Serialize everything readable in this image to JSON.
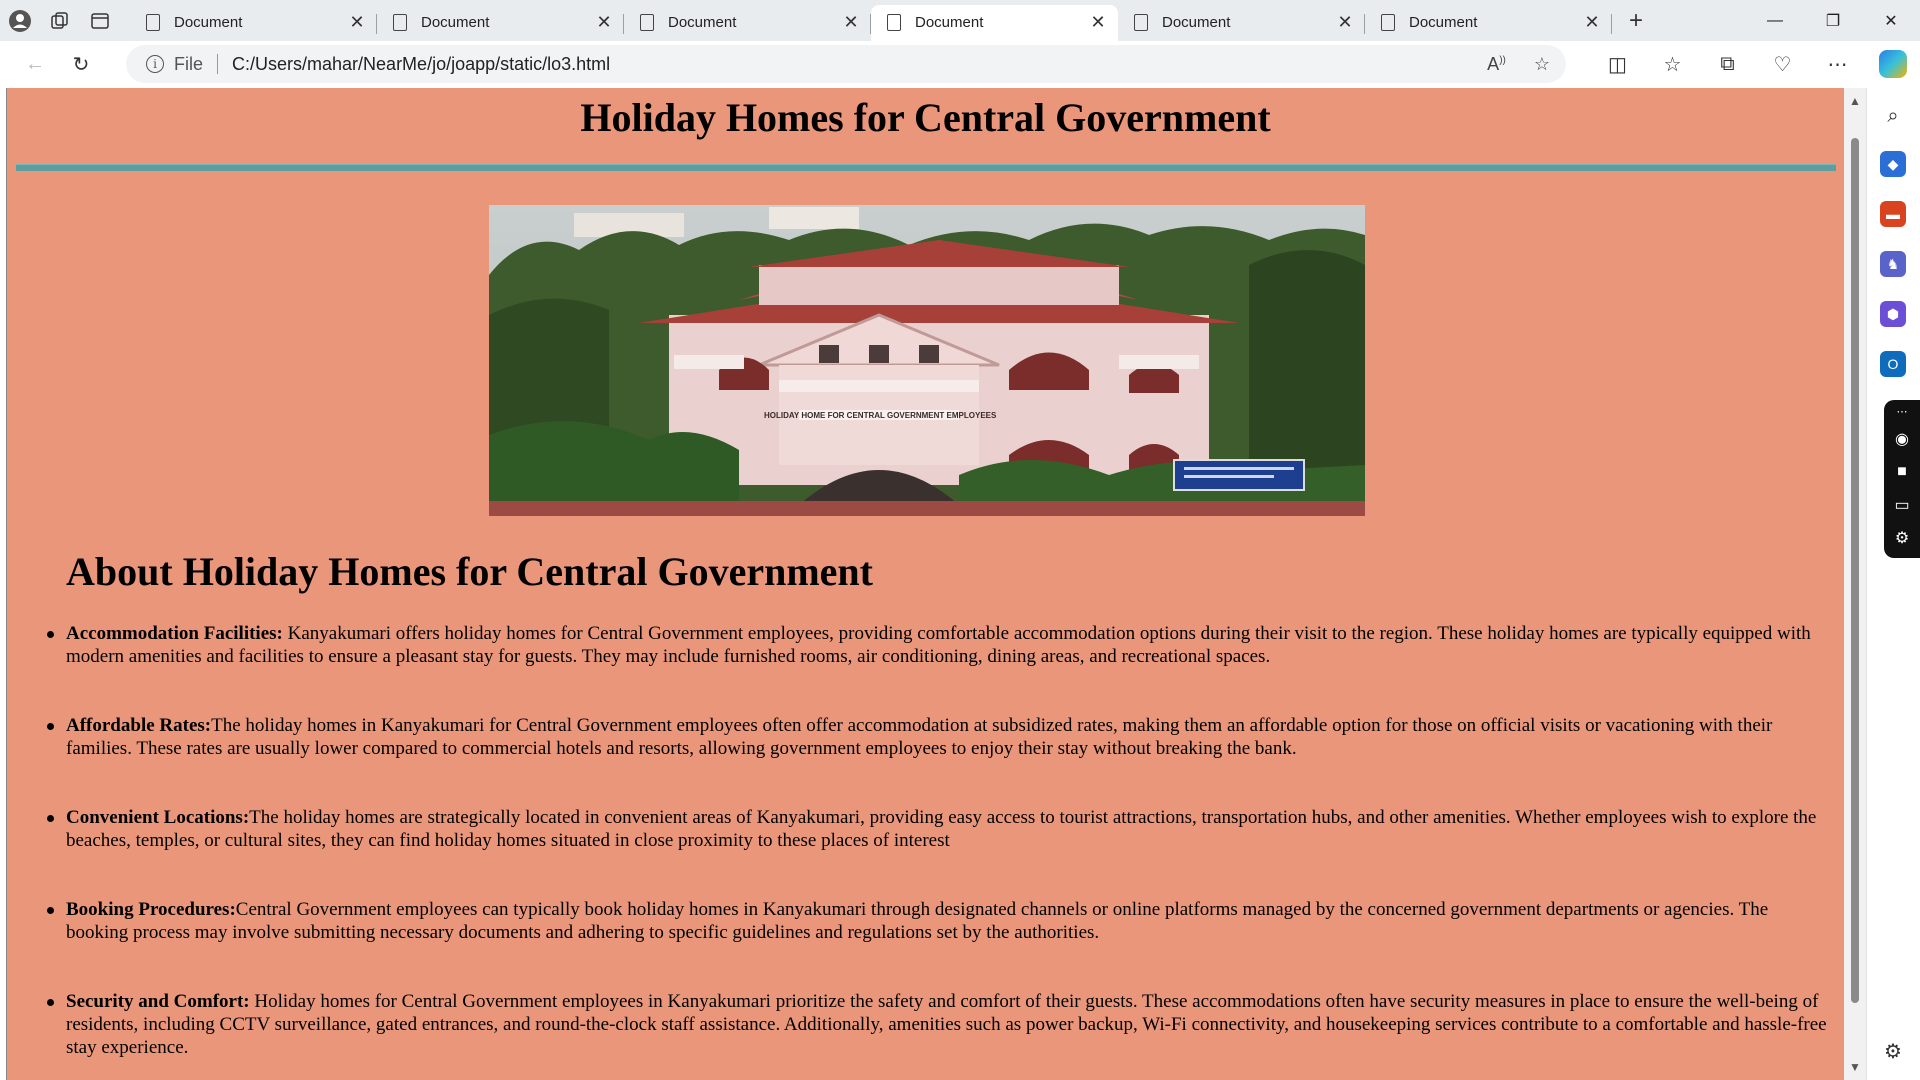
{
  "browser": {
    "tabs": [
      {
        "label": "Document",
        "active": false
      },
      {
        "label": "Document",
        "active": false
      },
      {
        "label": "Document",
        "active": false
      },
      {
        "label": "Document",
        "active": true
      },
      {
        "label": "Document",
        "active": false
      },
      {
        "label": "Document",
        "active": false
      }
    ],
    "address": {
      "scheme_label": "File",
      "url": "C:/Users/mahar/NearMe/jo/joapp/static/lo3.html"
    }
  },
  "page": {
    "title": "Holiday Homes for Central Government",
    "image_sign_text": "HOLIDAY HOME FOR CENTRAL GOVERNMENT EMPLOYEES",
    "about_heading": "About Holiday Homes for Central Government",
    "features": [
      {
        "heading": "Accommodation Facilities:",
        "text": " Kanyakumari offers holiday homes for Central Government employees, providing comfortable accommodation options during their visit to the region. These holiday homes are typically equipped with modern amenities and facilities to ensure a pleasant stay for guests. They may include furnished rooms, air conditioning, dining areas, and recreational spaces."
      },
      {
        "heading": "Affordable Rates:",
        "text": "The holiday homes in Kanyakumari for Central Government employees often offer accommodation at subsidized rates, making them an affordable option for those on official visits or vacationing with their families. These rates are usually lower compared to commercial hotels and resorts, allowing government employees to enjoy their stay without breaking the bank."
      },
      {
        "heading": "Convenient Locations:",
        "text": "The holiday homes are strategically located in convenient areas of Kanyakumari, providing easy access to tourist attractions, transportation hubs, and other amenities. Whether employees wish to explore the beaches, temples, or cultural sites, they can find holiday homes situated in close proximity to these places of interest"
      },
      {
        "heading": "Booking Procedures:",
        "text": "Central Government employees can typically book holiday homes in Kanyakumari through designated channels or online platforms managed by the concerned government departments or agencies. The booking process may involve submitting necessary documents and adhering to specific guidelines and regulations set by the authorities."
      },
      {
        "heading": "Security and Comfort:",
        "text": " Holiday homes for Central Government employees in Kanyakumari prioritize the safety and comfort of their guests. These accommodations often have security measures in place to ensure the well-being of residents, including CCTV surveillance, gated entrances, and round-the-clock staff assistance. Additionally, amenities such as power backup, Wi-Fi connectivity, and housekeeping services contribute to a comfortable and hassle-free stay experience."
      }
    ]
  },
  "colors": {
    "page_background": "#e9967a",
    "rule": "#5f9ea0"
  }
}
